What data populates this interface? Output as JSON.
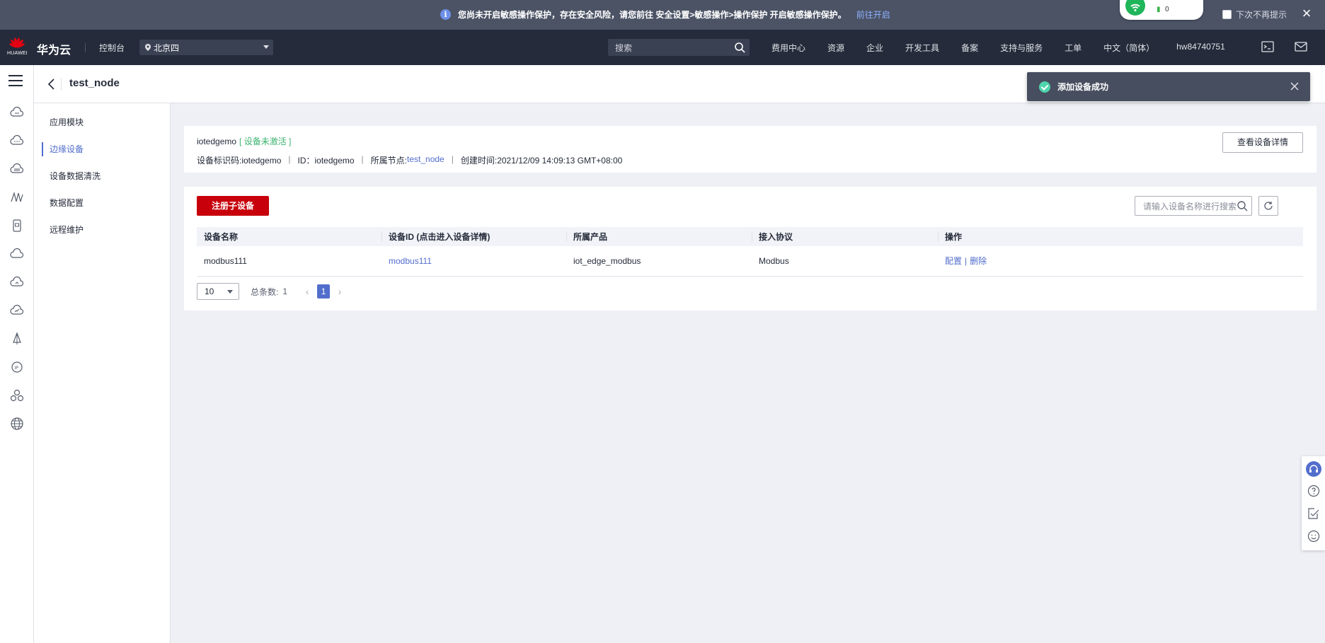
{
  "notice": {
    "message": "您尚未开启敏感操作保护，存在安全风险，请您前往 安全设置>敏感操作>操作保护 开启敏感操作保护。",
    "link": "前往开启",
    "no_remind": "下次不再提示",
    "close_icon": "close-icon"
  },
  "wifi_widget": {
    "count": "0"
  },
  "header": {
    "logo_text": "HUAWEI",
    "brand": "华为云",
    "console": "控制台",
    "region": "北京四",
    "search_placeholder": "搜索",
    "nav": [
      "费用中心",
      "资源",
      "企业",
      "开发工具",
      "备案",
      "支持与服务",
      "工单",
      "中文（简体）",
      "hw84740751"
    ],
    "icons": [
      "terminal-icon",
      "mail-icon"
    ]
  },
  "rail_icons": [
    "cloud-server-icon",
    "cloud-icon",
    "database-icon",
    "ai-icon",
    "device-icon",
    "cloud-storage-icon",
    "cloud-network-icon",
    "cloud-monitor-icon",
    "deploy-icon",
    "ip-icon",
    "cluster-icon",
    "globe-icon"
  ],
  "page": {
    "title": "test_node"
  },
  "subnav": {
    "items": [
      "应用模块",
      "边缘设备",
      "设备数据清洗",
      "数据配置",
      "远程维护"
    ],
    "active_index": 1
  },
  "toast": {
    "message": "添加设备成功"
  },
  "device_card": {
    "name": "iotedgemo",
    "status": "[ 设备未激活 ]",
    "id_label": "设备标识码:iotedgemo",
    "id2_label": "ID：iotedgemo",
    "node_label": "所属节点:",
    "node_value": "test_node",
    "created_label": "创建时间:2021/12/09 14:09:13 GMT+08:00",
    "detail_button": "查看设备详情"
  },
  "table": {
    "register_button": "注册子设备",
    "search_placeholder": "请输入设备名称进行搜索",
    "headers": [
      "设备名称",
      "设备ID (点击进入设备详情)",
      "所属产品",
      "接入协议",
      "操作"
    ],
    "rows": [
      {
        "name": "modbus111",
        "id": "modbus111",
        "product": "iot_edge_modbus",
        "protocol": "Modbus",
        "op_config": "配置",
        "op_delete": "删除"
      }
    ]
  },
  "pager": {
    "page_size": "10",
    "total_label": "总条数:",
    "total": "1",
    "current_page": "1"
  },
  "right_tools": [
    "headset-icon",
    "help-icon",
    "feedback-icon",
    "smile-icon"
  ],
  "colors": {
    "brand_red": "#c7000b",
    "link_blue": "#526ecc",
    "header_bg": "#252b3a",
    "status_green": "#3cb371"
  }
}
